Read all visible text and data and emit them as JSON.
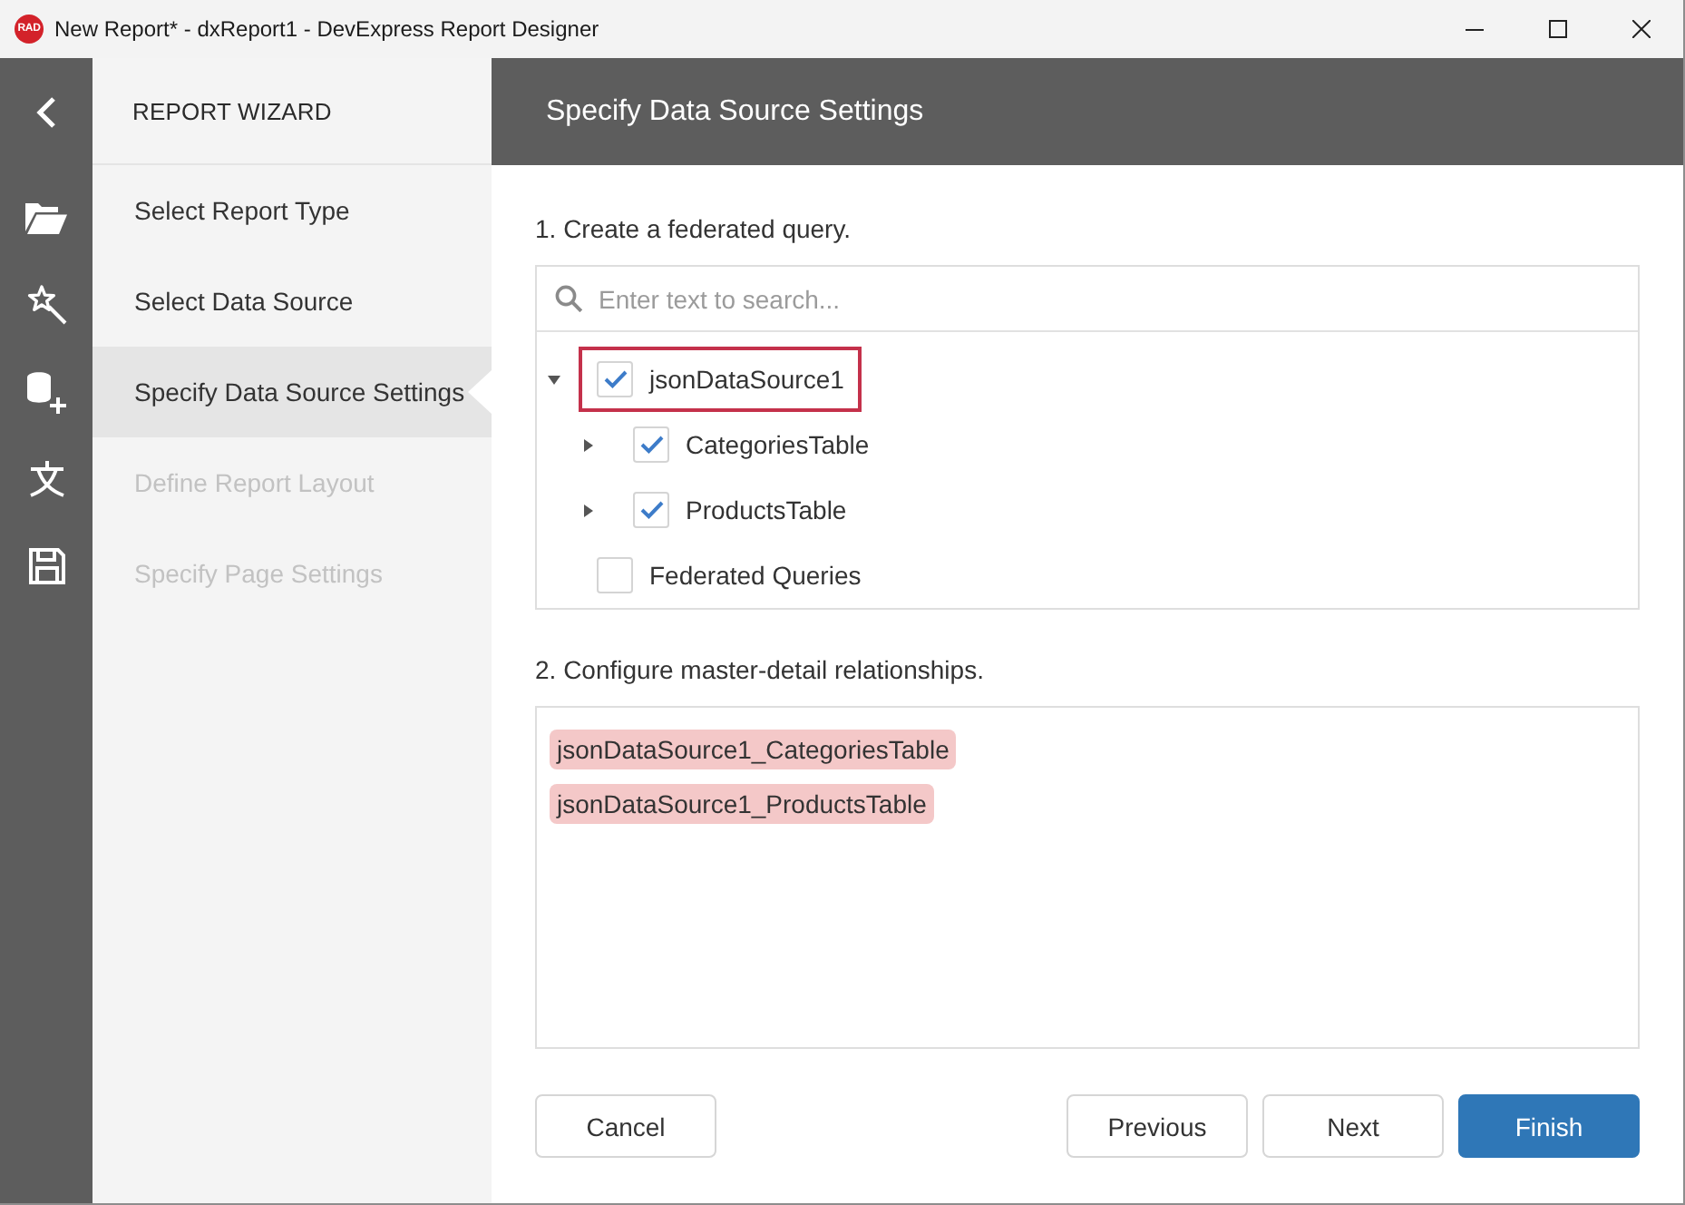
{
  "window": {
    "title": "New Report* - dxReport1 - DevExpress Report Designer",
    "logo_text": "RAD"
  },
  "wizard": {
    "title": "REPORT WIZARD",
    "steps": [
      {
        "label": "Select Report Type",
        "selected": false,
        "disabled": false
      },
      {
        "label": "Select Data Source",
        "selected": false,
        "disabled": false
      },
      {
        "label": "Specify Data Source Settings",
        "selected": true,
        "disabled": false
      },
      {
        "label": "Define Report Layout",
        "selected": false,
        "disabled": true
      },
      {
        "label": "Specify Page Settings",
        "selected": false,
        "disabled": true
      }
    ]
  },
  "page": {
    "title": "Specify Data Source Settings"
  },
  "query": {
    "label": "1. Create a federated query.",
    "search": {
      "placeholder": "Enter text to search..."
    },
    "tree": [
      {
        "label": "jsonDataSource1",
        "checked": true,
        "expanded": true,
        "focused": true,
        "children": [
          {
            "label": "CategoriesTable",
            "checked": true,
            "expanded": false,
            "focused": false
          },
          {
            "label": "ProductsTable",
            "checked": true,
            "expanded": false,
            "focused": false
          }
        ]
      },
      {
        "label": "Federated Queries",
        "checked": false,
        "focused": false
      }
    ]
  },
  "relations": {
    "label": "2. Configure master-detail relationships.",
    "items": [
      {
        "label": "jsonDataSource1_CategoriesTable"
      },
      {
        "label": "jsonDataSource1_ProductsTable"
      }
    ]
  },
  "footer": {
    "left_buttons": [
      {
        "label": "Cancel",
        "kind": "default"
      }
    ],
    "right_buttons": [
      {
        "label": "Previous",
        "kind": "default"
      },
      {
        "label": "Next",
        "kind": "default"
      },
      {
        "label": "Finish",
        "kind": "primary"
      }
    ]
  }
}
